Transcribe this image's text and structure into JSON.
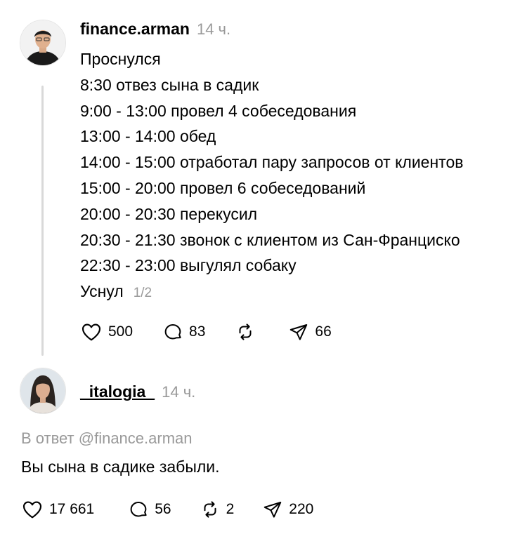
{
  "post": {
    "username": "finance.arman",
    "time": "14 ч.",
    "lines": [
      "Проснулся",
      "8:30 отвез сына в садик",
      "9:00 - 13:00 провел 4 собеседования",
      "13:00 - 14:00 обед",
      "14:00 - 15:00 отработал пару запросов от клиентов",
      "15:00 - 20:00 провел 6 собеседований",
      "20:00 - 20:30 перекусил",
      "20:30 - 21:30 звонок с клиентом из Сан-Франциско",
      "22:30 - 23:00 выгулял собаку",
      "Уснул"
    ],
    "pager": "1/2",
    "likes": "500",
    "comments": "83",
    "shares": "66"
  },
  "reply": {
    "username": "_italogia_",
    "time": "14 ч.",
    "reply_to": "В ответ @finance.arman",
    "text": "Вы сына в садике забыли.",
    "likes": "17 661",
    "comments": "56",
    "reposts": "2",
    "shares": "220"
  },
  "icons": [
    "heart-icon",
    "comment-icon",
    "repost-icon",
    "share-icon"
  ]
}
